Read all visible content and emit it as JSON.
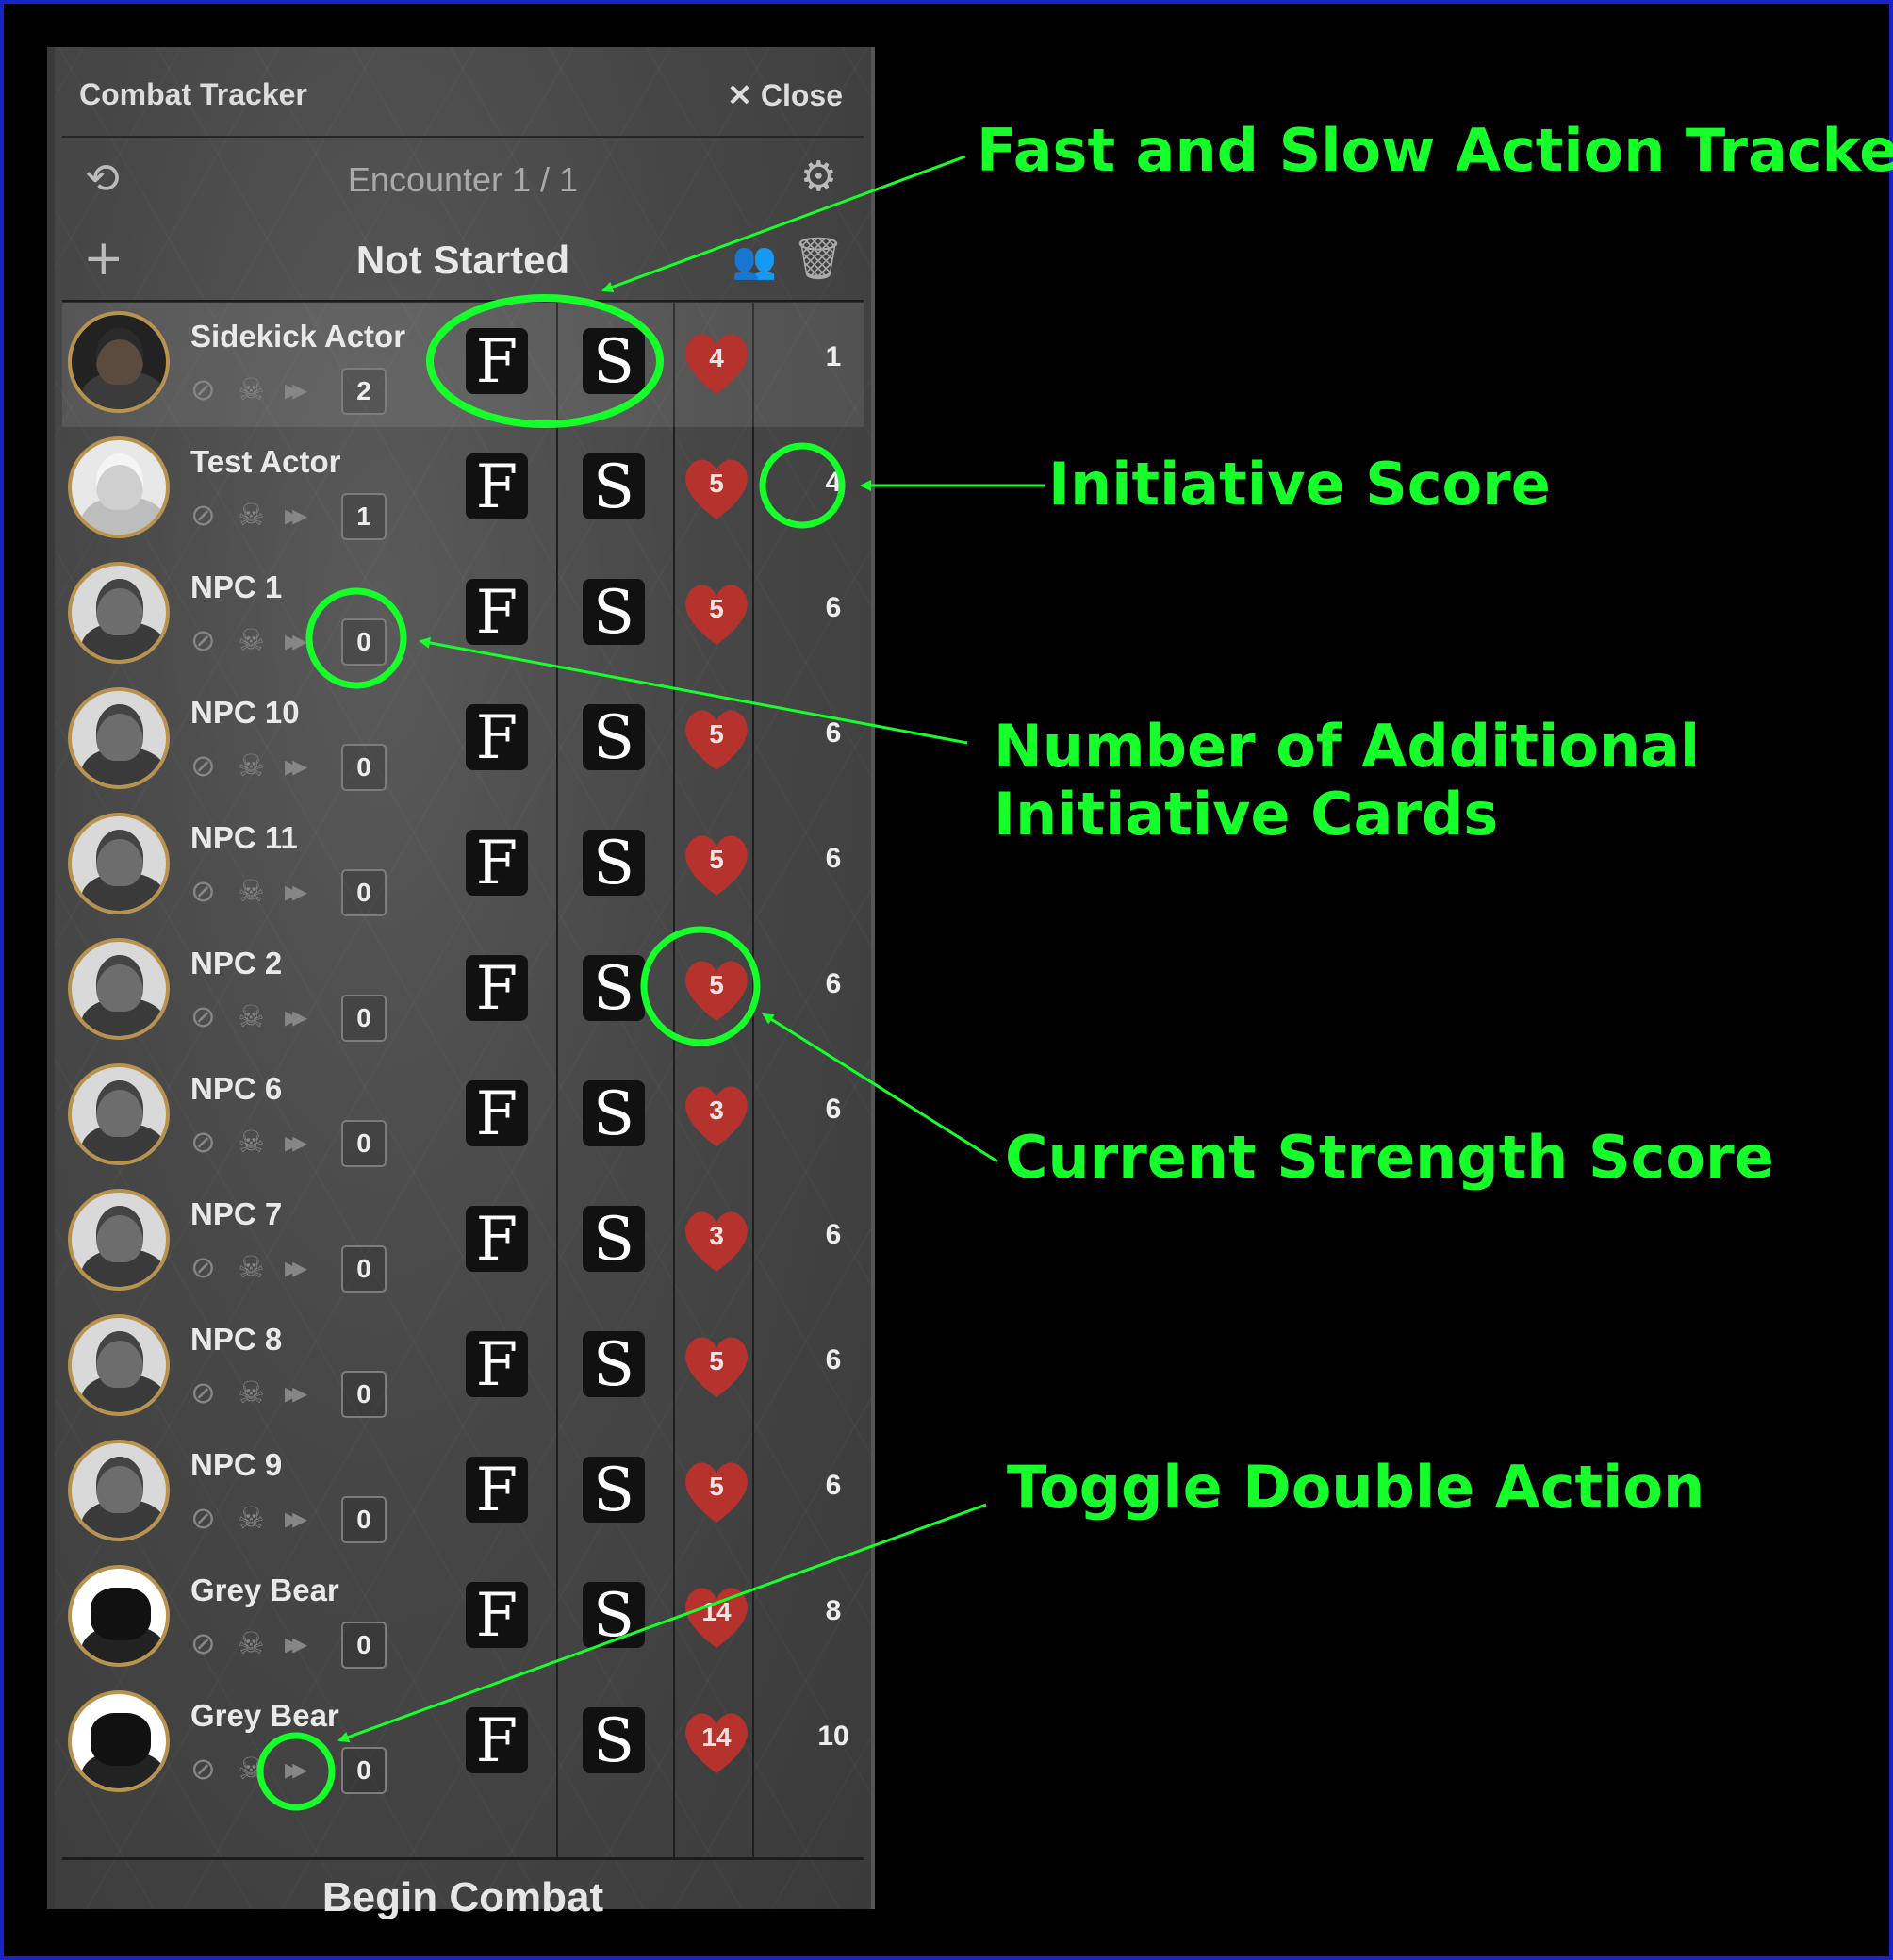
{
  "tracker": {
    "title": "Combat Tracker",
    "close_label": "✕ Close",
    "encounter": "Encounter 1 / 1",
    "state": "Not Started",
    "footer_button": "Begin Combat",
    "icons": {
      "undo": "undo-icon",
      "settings": "gear-icon",
      "add": "plus-icon",
      "group": "users-icon",
      "delete": "trash-icon",
      "hidden": "eye-slash-icon",
      "defeated": "skull-icon",
      "double_action": "double-chevron-icon",
      "strength": "heart-icon"
    },
    "fast_label": "F",
    "slow_label": "S",
    "combatants": [
      {
        "name": "Sidekick Actor",
        "cards": "2",
        "strength": "4",
        "initiative": "1",
        "avatar": "hood",
        "active": true
      },
      {
        "name": "Test Actor",
        "cards": "1",
        "strength": "5",
        "initiative": "4",
        "avatar": "white",
        "active": false
      },
      {
        "name": "NPC 1",
        "cards": "0",
        "strength": "5",
        "initiative": "6",
        "avatar": "npc",
        "active": false
      },
      {
        "name": "NPC 10",
        "cards": "0",
        "strength": "5",
        "initiative": "6",
        "avatar": "npc",
        "active": false
      },
      {
        "name": "NPC 11",
        "cards": "0",
        "strength": "5",
        "initiative": "6",
        "avatar": "npc",
        "active": false
      },
      {
        "name": "NPC 2",
        "cards": "0",
        "strength": "5",
        "initiative": "6",
        "avatar": "npc",
        "active": false
      },
      {
        "name": "NPC 6",
        "cards": "0",
        "strength": "3",
        "initiative": "6",
        "avatar": "npc",
        "active": false
      },
      {
        "name": "NPC 7",
        "cards": "0",
        "strength": "3",
        "initiative": "6",
        "avatar": "npc",
        "active": false
      },
      {
        "name": "NPC 8",
        "cards": "0",
        "strength": "5",
        "initiative": "6",
        "avatar": "npc",
        "active": false
      },
      {
        "name": "NPC 9",
        "cards": "0",
        "strength": "5",
        "initiative": "6",
        "avatar": "npc",
        "active": false
      },
      {
        "name": "Grey Bear",
        "cards": "0",
        "strength": "14",
        "initiative": "8",
        "avatar": "bear",
        "active": false
      },
      {
        "name": "Grey Bear",
        "cards": "0",
        "strength": "14",
        "initiative": "10",
        "avatar": "bear",
        "active": false
      }
    ]
  },
  "annotations": {
    "fast_slow": "Fast and Slow Action Tracker",
    "initiative": "Initiative Score",
    "cards_line1": "Number of Additional",
    "cards_line2": "Initiative Cards",
    "strength": "Current Strength Score",
    "double": "Toggle Double Action",
    "color": "#16ff2a"
  },
  "colors": {
    "frame": "#1a23c8",
    "heart": "#b5322d",
    "avatar_ring": "#b89350"
  }
}
